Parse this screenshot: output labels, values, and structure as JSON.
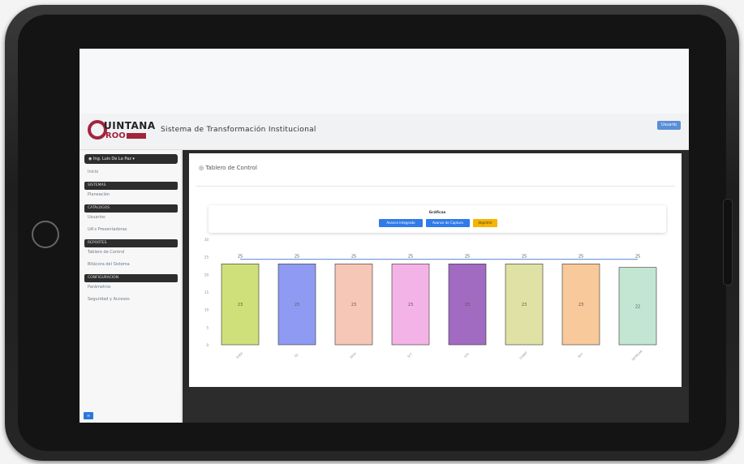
{
  "header": {
    "title": "Sistema de Transformación Institucional",
    "logo_line1": "UINTANA",
    "logo_line2": "ROO",
    "user_badge": "Usuario"
  },
  "sidebar": {
    "profile": "Ing. Luis De La Paz",
    "items": [
      {
        "type": "item",
        "label": "Inicio"
      },
      {
        "type": "head",
        "label": "SISTEMAS"
      },
      {
        "type": "item",
        "label": "Planeación"
      },
      {
        "type": "head",
        "label": "CATÁLOGOS"
      },
      {
        "type": "item",
        "label": "Usuarios"
      },
      {
        "type": "item",
        "label": "UA's Presentadoras"
      },
      {
        "type": "head",
        "label": "REPORTES"
      },
      {
        "type": "item",
        "label": "Tablero de Control"
      },
      {
        "type": "item",
        "label": "Bitácora del Sistema"
      },
      {
        "type": "head",
        "label": "CONFIGURACIÓN"
      },
      {
        "type": "item",
        "label": "Parámetros"
      },
      {
        "type": "item",
        "label": "Seguridad y Accesos"
      }
    ]
  },
  "panel": {
    "title": "Tablero de Control",
    "graphs_label": "Gráficas",
    "buttons": [
      {
        "label": "Avance Integrado",
        "color": "#2f7bea"
      },
      {
        "label": "Avance de Captura",
        "color": "#2f7bea"
      },
      {
        "label": "Imprimir",
        "color": "#f5b400"
      }
    ]
  },
  "chart_data": {
    "type": "bar",
    "categories": [
      "SHEA",
      "SQ",
      "SESA",
      "SCT",
      "STS",
      "COBAT",
      "SEV",
      "SEFIPLAN"
    ],
    "values": [
      23,
      23,
      23,
      23,
      23,
      23,
      23,
      22
    ],
    "top_labels": [
      25,
      25,
      25,
      25,
      25,
      25,
      25,
      25
    ],
    "colors": [
      "#cfe07a",
      "#8f9bf2",
      "#f6c7b7",
      "#f3b3e6",
      "#a06bc0",
      "#e0e1a4",
      "#f8c99a",
      "#c3e6d3"
    ],
    "ylim": [
      0,
      30
    ],
    "yticks": [
      0,
      5,
      10,
      15,
      20,
      25,
      30
    ]
  }
}
